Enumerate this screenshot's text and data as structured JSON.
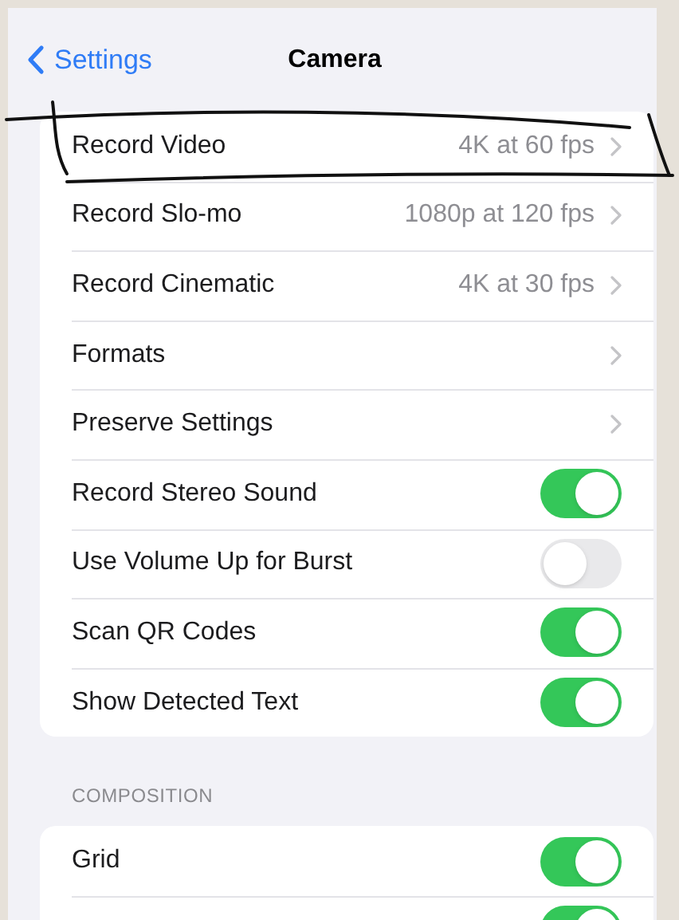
{
  "nav_bar": {
    "back_label": "Settings",
    "title": "Camera"
  },
  "sections": [
    {
      "items": [
        {
          "kind": "link",
          "label": "Record Video",
          "value": "4K at 60 fps"
        },
        {
          "kind": "link",
          "label": "Record Slo-mo",
          "value": "1080p at 120 fps"
        },
        {
          "kind": "link",
          "label": "Record Cinematic",
          "value": "4K at 30 fps"
        },
        {
          "kind": "link",
          "label": "Formats"
        },
        {
          "kind": "link",
          "label": "Preserve Settings"
        },
        {
          "kind": "toggle",
          "label": "Record Stereo Sound",
          "on": true
        },
        {
          "kind": "toggle",
          "label": "Use Volume Up for Burst",
          "on": false
        },
        {
          "kind": "toggle",
          "label": "Scan QR Codes",
          "on": true
        },
        {
          "kind": "toggle",
          "label": "Show Detected Text",
          "on": true
        }
      ]
    },
    {
      "header": "COMPOSITION",
      "items": [
        {
          "kind": "toggle",
          "label": "Grid",
          "on": true
        },
        {
          "kind": "toggle",
          "on": true
        }
      ]
    }
  ]
}
